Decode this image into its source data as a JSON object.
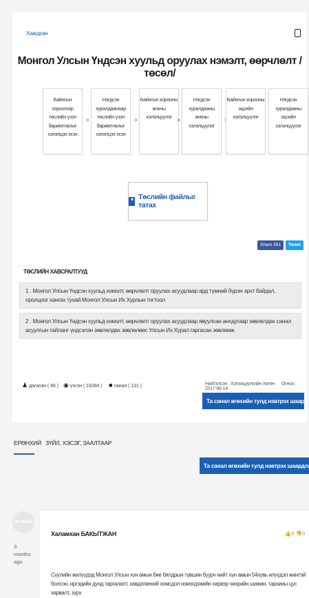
{
  "post": {
    "status": "Хаагдсан",
    "title": "Монгол Улсын Үндсэн хуульд оруулах нэмэлт, өөрчлөлт /төсөл/",
    "steps": [
      "Байнгын хороогоор төслийн үзэл баримтлалыг хэлэлцэх эсэх",
      "Нэгдсэн хуралдаанаар төслийн үзэл баримтлалыг хэлэлцэх эсэх",
      "Байнгын хорооны анхны хэлэлцүүлэг",
      "Нэгдсэн хуралдааны анхны хэлэлцүүлэг",
      "Байнгын хорооны эцсийн хэлэлцүүлэг",
      "Нэгдсэн хуралдааны эцсийн хэлэлцүүлэг"
    ],
    "step_arrow": ">",
    "download_label": "Төслийн файлыг татах",
    "share_label": "Share 391",
    "tweet_label": "Tweet",
    "attachments_heading": "ТӨСЛИЙН ХАВСРАЛТУУД",
    "attachments": [
      "1 . Монгол Улсын Үндсэн хуульд нэмэлт, өөрчлөлт оруулах асуудлаар ард түмний бүрэн эрхт байдал, оролцоог хангах тухай Монгол Улсын Их Хурлын тогтоол",
      "2 . Монгол Улсын Үндсэн хуульд нэмэлт, өөрчлөлт оруулах асуудлаар явуулсан анхдугаар зөвлөлдөх санал асуулгын тайланг үндсэлэн зөвлөлдөх зөвлөлөөс Улсын Их Хурал гаргасан зөвлөмж"
    ],
    "stats": {
      "followers": "дагасан ( 46 )",
      "views": "үзсэн ( 19284 )",
      "comments": "санал ( 131 )"
    },
    "publisher": "Нийтэлсэн : Хэлэлцүүлгийн Хөтөч",
    "date": "Огноо : 2017-06-14",
    "cta_label": "Та санал өгөхийн тулд нэвтрэх шаардлагатай!"
  },
  "tabs": [
    "ЕРӨНХИЙ",
    "ЗҮЙЛ, ХЭСЭГ, ЗААЛТААР"
  ],
  "cta_label_2": "Та санал өгөхийн тулд нэвтрэх шаардлагатай!",
  "comment": {
    "avatar_text": "NO IMAGE",
    "ago": "3 months ago",
    "author": "Халамхан БАКЫТЖАН",
    "votes": "👍0  👎0",
    "text": "Сүүлийн жилүүдэд Монгол Улсын хүн амын бие бялдрын түвшин буурч нийт хүн амын 54хувь илүүдэл жинтэй болсон, иргэдийн дунд таргалалт, хавдлгвений хомсдол нэмэгдэжийн хирвэр чихрийн шижин, тархины цус харвалт, зүрх"
  }
}
